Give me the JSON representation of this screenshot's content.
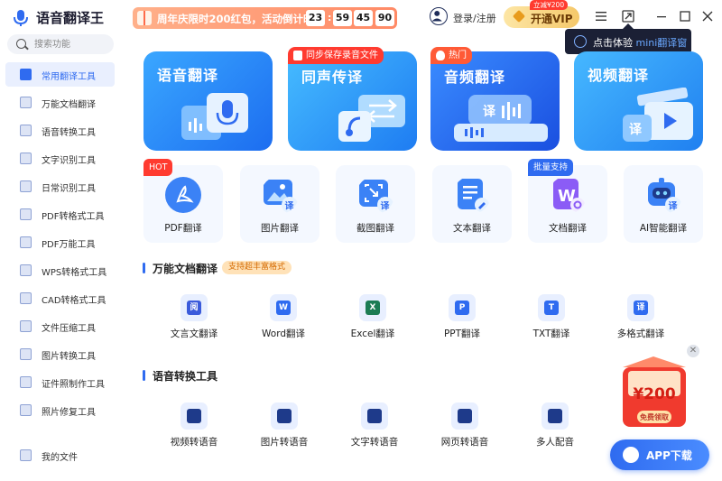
{
  "app": {
    "name": "语音翻译王"
  },
  "promo": {
    "text": "周年庆限时200红包，活动倒计时",
    "timer": [
      "23",
      "59",
      "45",
      "90"
    ]
  },
  "header": {
    "login": "登录/注册",
    "vip": "开通VIP",
    "vip_tag": "立减¥200"
  },
  "mini_tip": {
    "prefix": "点击体验",
    "highlight": "mini翻译窗"
  },
  "search": {
    "placeholder": "搜索功能"
  },
  "sidebar": {
    "items": [
      {
        "label": "常用翻译工具",
        "active": true
      },
      {
        "label": "万能文档翻译"
      },
      {
        "label": "语音转换工具"
      },
      {
        "label": "文字识别工具"
      },
      {
        "label": "日常识别工具"
      },
      {
        "label": "PDF转格式工具"
      },
      {
        "label": "PDF万能工具"
      },
      {
        "label": "WPS转格式工具"
      },
      {
        "label": "CAD转格式工具"
      },
      {
        "label": "文件压缩工具"
      },
      {
        "label": "图片转换工具"
      },
      {
        "label": "证件照制作工具"
      },
      {
        "label": "照片修复工具"
      }
    ],
    "footer": "我的文件"
  },
  "big_cards": [
    {
      "title": "语音翻译"
    },
    {
      "title": "同声传译",
      "badge": "同步保存录音文件"
    },
    {
      "title": "音频翻译",
      "badge": "热门"
    },
    {
      "title": "视频翻译"
    }
  ],
  "tools": [
    {
      "label": "PDF翻译",
      "badge": "HOT"
    },
    {
      "label": "图片翻译"
    },
    {
      "label": "截图翻译"
    },
    {
      "label": "文本翻译"
    },
    {
      "label": "文档翻译",
      "badge": "批量支持"
    },
    {
      "label": "AI智能翻译"
    }
  ],
  "section_doc": {
    "title": "万能文档翻译",
    "tag": "支持超丰富格式",
    "items": [
      {
        "label": "文言文翻译",
        "glyph": "阅"
      },
      {
        "label": "Word翻译",
        "glyph": "W"
      },
      {
        "label": "Excel翻译",
        "glyph": "X"
      },
      {
        "label": "PPT翻译",
        "glyph": "P"
      },
      {
        "label": "TXT翻译",
        "glyph": "T"
      },
      {
        "label": "多格式翻译",
        "glyph": "译"
      }
    ]
  },
  "section_voice": {
    "title": "语音转换工具",
    "items": [
      {
        "label": "视频转语音"
      },
      {
        "label": "图片转语音"
      },
      {
        "label": "文字转语音"
      },
      {
        "label": "网页转语音"
      },
      {
        "label": "多人配音"
      }
    ]
  },
  "redpack": {
    "amount": "¥200",
    "cta": "免费领取"
  },
  "app_download": {
    "label": "APP下载"
  },
  "colors": {
    "accent": "#2f6bf0",
    "hot": "#ff3b30"
  }
}
